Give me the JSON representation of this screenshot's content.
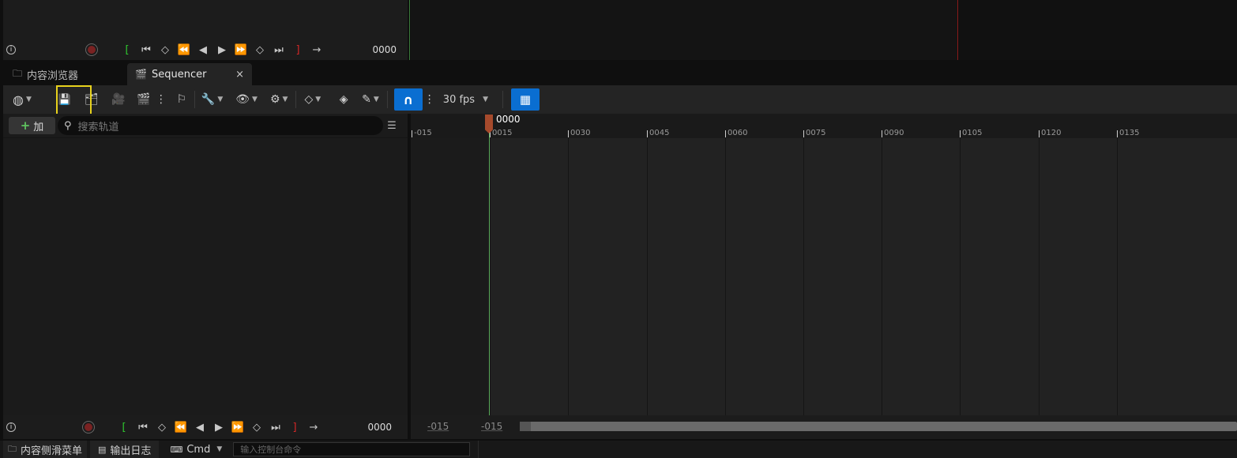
{
  "top_transport": {
    "frame": "0000"
  },
  "tabs": [
    {
      "label": "内容浏览器"
    },
    {
      "label": "Sequencer"
    }
  ],
  "toolbar": {
    "fps": "30 fps"
  },
  "left_panel": {
    "add_label": "加",
    "search_placeholder": "搜索轨道"
  },
  "timeline": {
    "current_frame": "0000",
    "ruler_labels": [
      "-015",
      "0015",
      "0030",
      "0045",
      "0060",
      "0075",
      "0090",
      "0105",
      "0120",
      "0135"
    ]
  },
  "bottom_transport": {
    "frame": "0000",
    "range_start": "-015",
    "range_end": "-015"
  },
  "statusbar": {
    "content_drawer": "内容侧滑菜单",
    "output_log": "输出日志",
    "cmd": "Cmd",
    "console_placeholder": "输入控制台命令"
  },
  "colors": {
    "accent_blue": "#0a6ed1",
    "highlight_yellow": "#e8d21d",
    "playhead": "#a64a2c",
    "playhead_line": "#5aaa5a",
    "range_start_green": "#2fc72f",
    "range_end_red": "#d62727"
  },
  "icons": {
    "save": "save-icon",
    "world": "world-icon",
    "snap": "magnet-icon",
    "curve_editor": "curve-editor-icon"
  }
}
